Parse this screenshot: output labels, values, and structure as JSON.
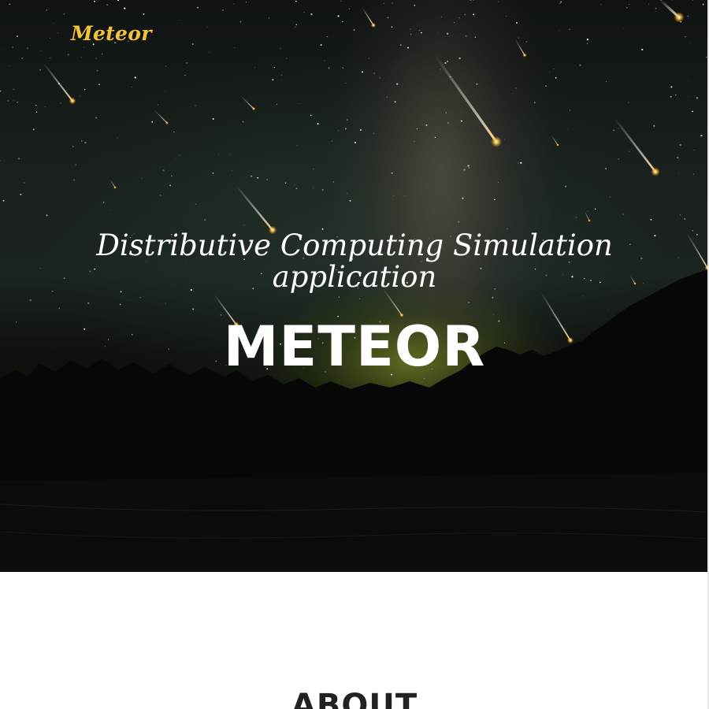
{
  "hero": {
    "logo": "Meteor",
    "subtitle": "Distributive Computing Simulation application",
    "title": "METEOR",
    "accent_color": "#f2c23a"
  },
  "about": {
    "heading": "ABOUT"
  }
}
